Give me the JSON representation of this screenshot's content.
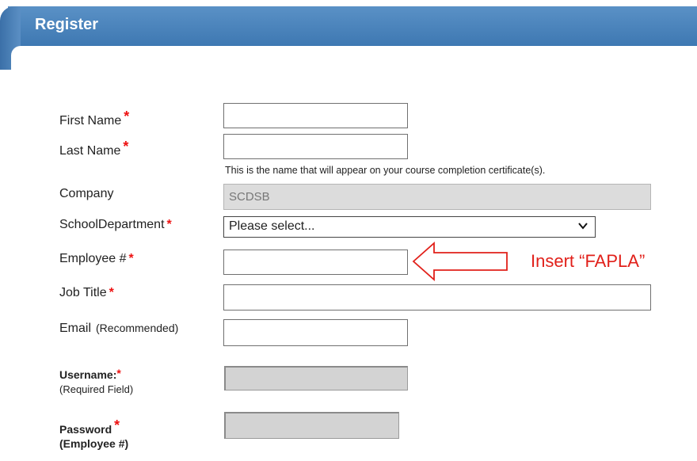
{
  "header": {
    "title": "Register"
  },
  "form": {
    "first_name": {
      "label": "First Name",
      "required_mark": "*",
      "value": ""
    },
    "last_name": {
      "label": "Last Name",
      "required_mark": "*",
      "value": ""
    },
    "name_hint": "This is the name that will appear on your course completion certificate(s).",
    "company": {
      "label": "Company",
      "value": "SCDSB"
    },
    "school_department": {
      "label": "SchoolDepartment",
      "required_mark": "*",
      "selected": "Please select..."
    },
    "employee": {
      "label": "Employee #",
      "required_mark": "*",
      "value": ""
    },
    "job_title": {
      "label": "Job Title",
      "required_mark": "*",
      "value": ""
    },
    "email": {
      "label": "Email",
      "note": "(Recommended)",
      "value": ""
    },
    "username": {
      "label": "Username:",
      "required_mark": "*",
      "sub": "(Required Field)",
      "value": ""
    },
    "password": {
      "label": "Password",
      "required_mark": "*",
      "sub": "(Employee #)",
      "value": ""
    }
  },
  "annotation": {
    "text": "Insert “FAPLA”",
    "color": "#e1201a"
  },
  "icons": {
    "select_chevron": "chevron-down-icon",
    "annotation_arrow": "arrow-left-icon"
  }
}
